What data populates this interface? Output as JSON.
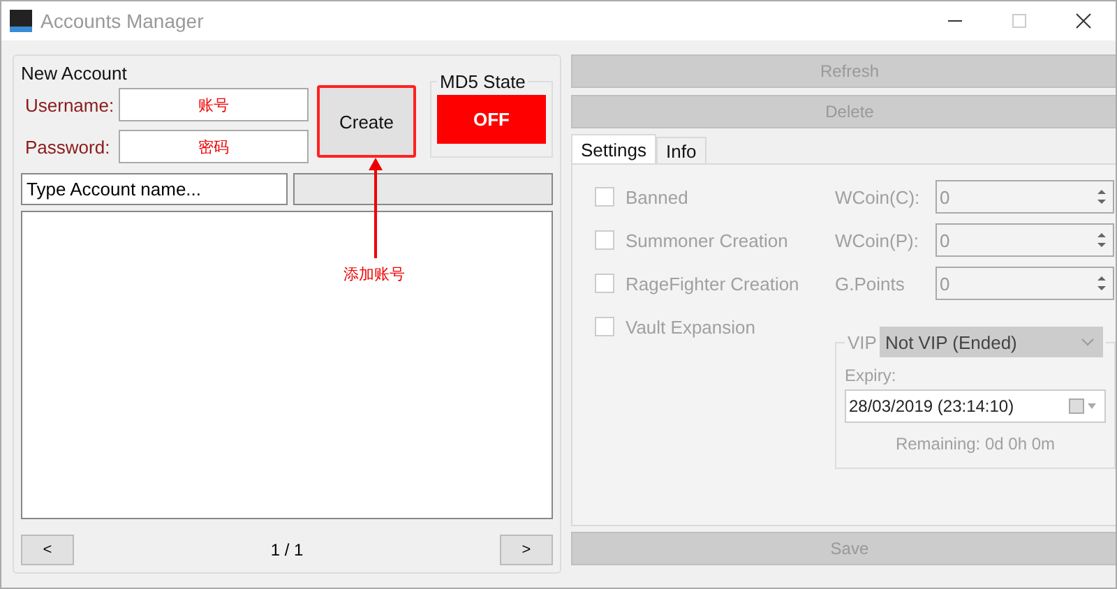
{
  "window": {
    "title": "Accounts Manager"
  },
  "new_account": {
    "title": "New Account",
    "fields": [
      {
        "label": "Username:",
        "value": "账号"
      },
      {
        "label": "Password:",
        "value": "密码"
      }
    ],
    "create_button": "Create"
  },
  "md5_state": {
    "title": "MD5 State",
    "value": "OFF",
    "on": false
  },
  "search": {
    "value": "Type Account name..."
  },
  "pager": {
    "prev": "<",
    "page": "1 / 1",
    "next": ">"
  },
  "annotation": {
    "text": "添加账号"
  },
  "top_actions": [
    {
      "label": "Refresh",
      "disabled": true
    },
    {
      "label": "Delete",
      "disabled": true
    }
  ],
  "tabs": [
    {
      "label": "Settings",
      "selected": true
    },
    {
      "label": "Info",
      "selected": false
    }
  ],
  "checkboxes": [
    {
      "label": "Banned",
      "checked": false,
      "disabled": true
    },
    {
      "label": "Summoner Creation",
      "checked": false,
      "disabled": true
    },
    {
      "label": "RageFighter Creation",
      "checked": false,
      "disabled": true
    },
    {
      "label": "Vault Expansion",
      "checked": false,
      "disabled": true
    }
  ],
  "numbers": [
    {
      "label": "WCoin(C):",
      "value": "0"
    },
    {
      "label": "WCoin(P):",
      "value": "0"
    },
    {
      "label": "G.Points",
      "value": "0"
    }
  ],
  "vip": {
    "title": "VIP",
    "select": "Not VIP (Ended)",
    "expiry_label": "Expiry:",
    "expiry_value": "28/03/2019 (23:14:10)",
    "remaining": "Remaining: 0d 0h 0m"
  },
  "save": {
    "label": "Save",
    "disabled": true
  }
}
